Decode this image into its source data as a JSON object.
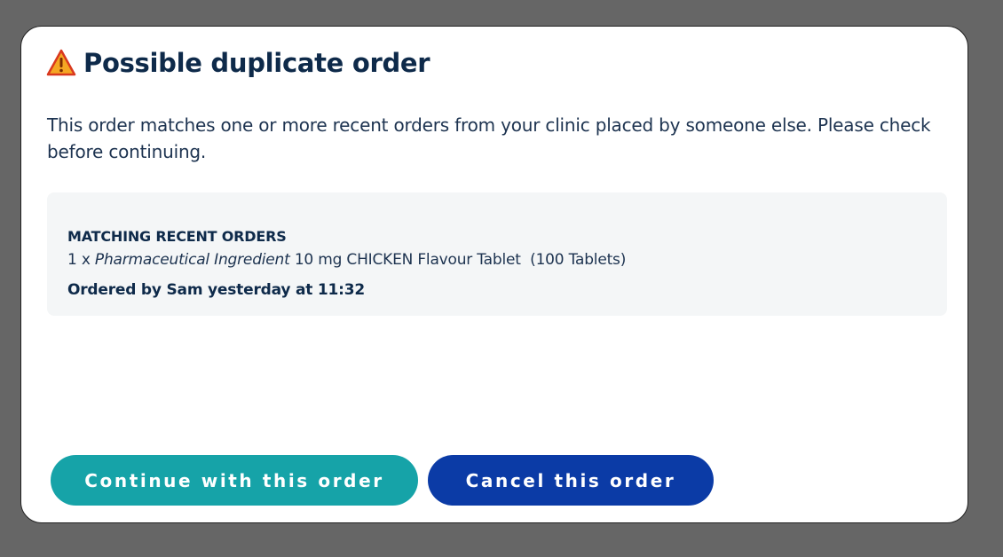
{
  "dialog": {
    "title": "Possible duplicate order",
    "description": "This order matches one or more recent orders from your clinic placed by someone else. Please check before continuing.",
    "matches": {
      "heading": "MATCHING RECENT ORDERS",
      "order": {
        "quantity_prefix": "1 x ",
        "ingredient": "Pharmaceutical Ingredient",
        "product_details": " 10 mg CHICKEN Flavour Tablet  (100 Tablets)"
      },
      "ordered_by": "Ordered by Sam yesterday at 11:32"
    },
    "buttons": {
      "continue_label": "Continue with this order",
      "cancel_label": "Cancel this order"
    }
  },
  "icons": {
    "title_icon": "warning-icon"
  },
  "colors": {
    "title_text": "#0e2a4a",
    "continue_button": "#16a3a8",
    "cancel_button": "#0b3ba6",
    "warning_fill": "#f5a623",
    "warning_stroke": "#d9381e",
    "overlay": "#666666"
  }
}
